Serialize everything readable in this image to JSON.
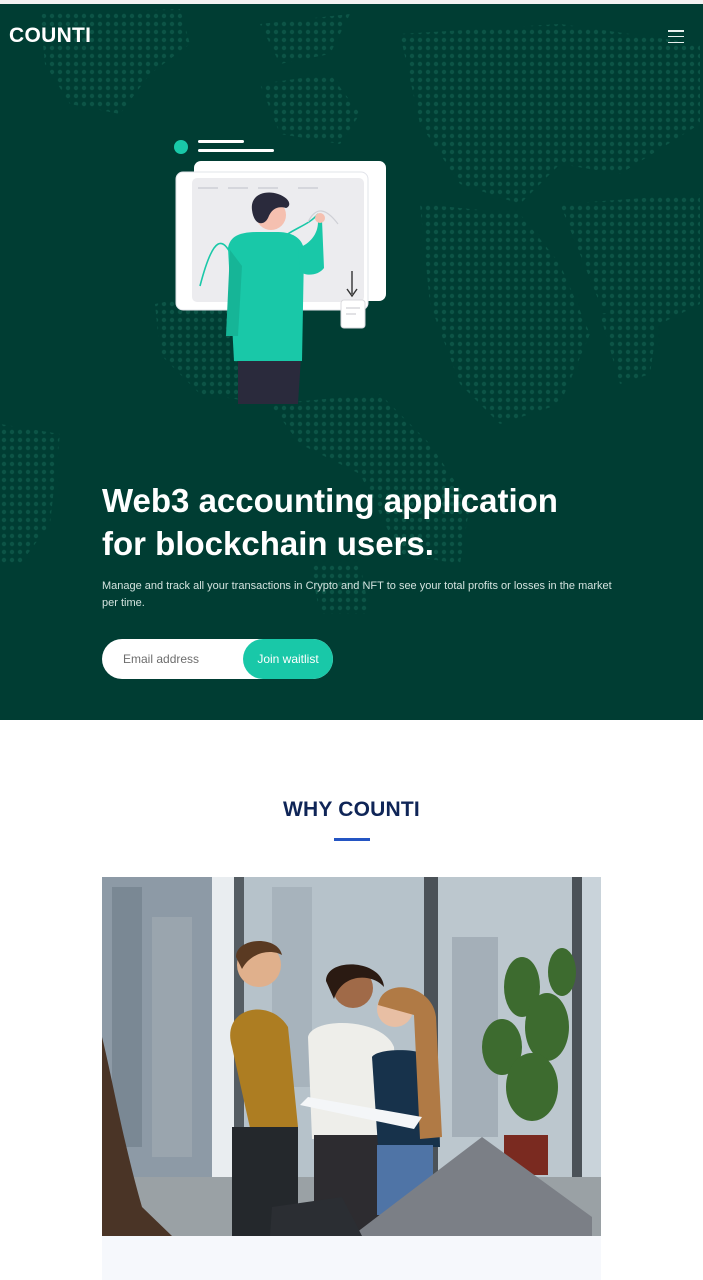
{
  "header": {
    "logo": "COUNTI",
    "menu_icon": "hamburger-menu-icon"
  },
  "hero": {
    "headline_line1": "Web3 accounting application",
    "headline_line2": "for blockchain users.",
    "subtext": "Manage and track all your transactions in Crypto and NFT to see your total profits or losses in the market per time.",
    "email_placeholder": "Email address",
    "email_value": "",
    "join_label": "Join waitlist",
    "background_color": "#003d33",
    "accent_color": "#19c8a8"
  },
  "why": {
    "title": "WHY COUNTI",
    "title_color": "#0f2557",
    "underline_color": "#2455c3"
  }
}
